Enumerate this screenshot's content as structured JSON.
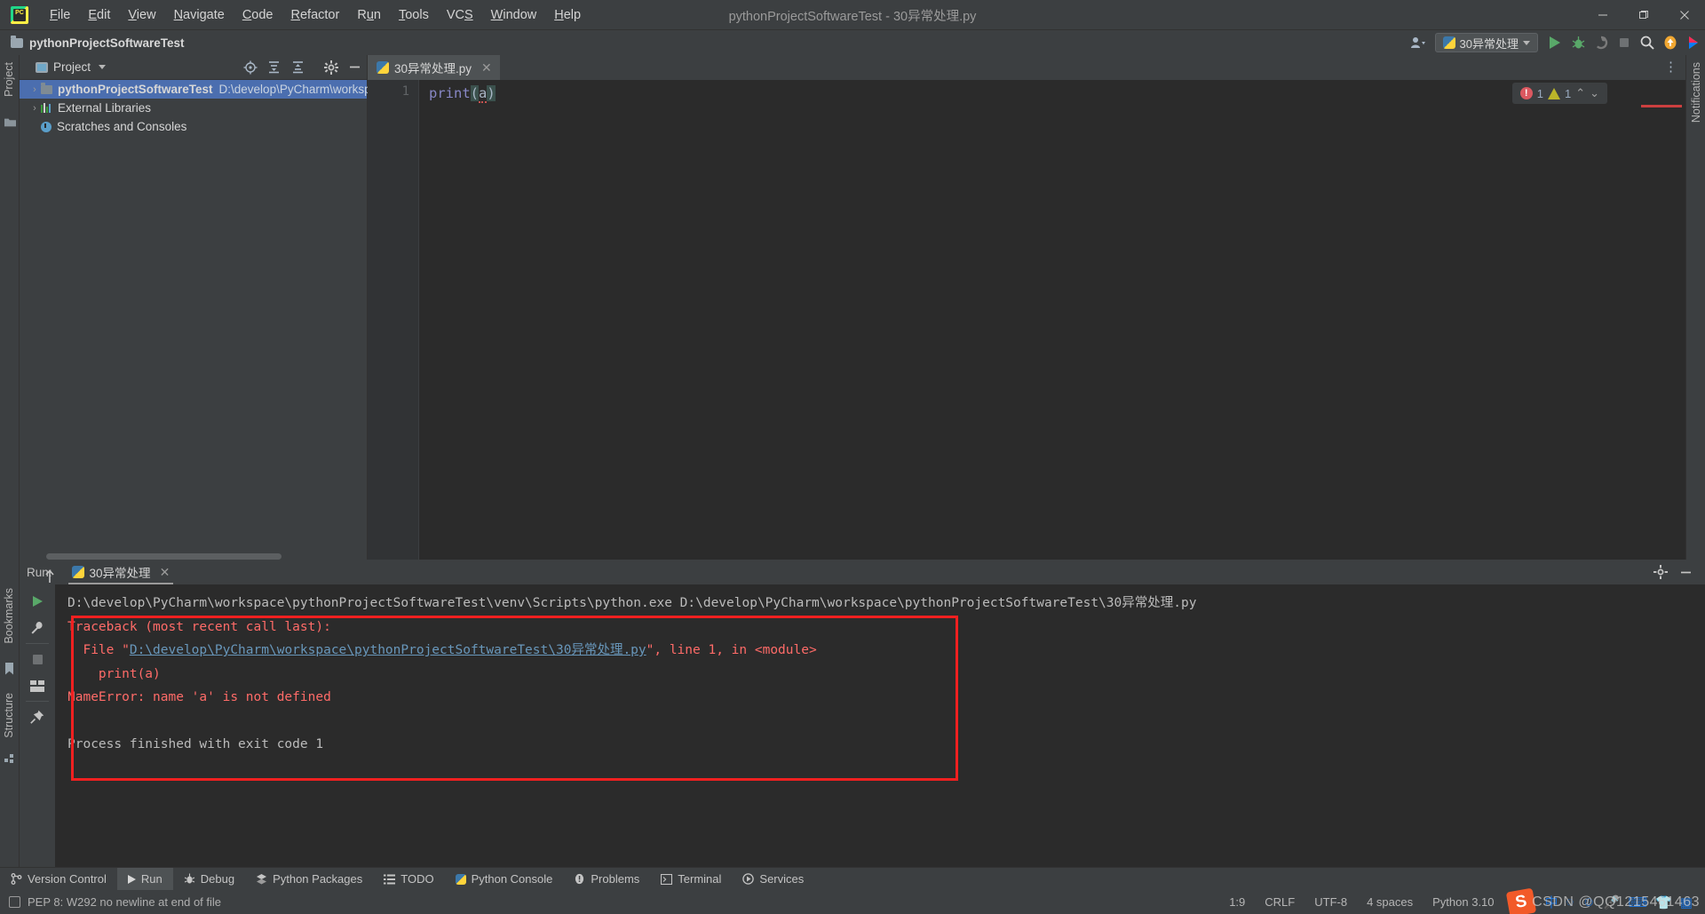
{
  "window": {
    "title": "pythonProjectSoftwareTest - 30异常处理.py",
    "minimize": "—",
    "maximize": "❐",
    "close": "✕"
  },
  "menu": {
    "items": [
      {
        "label": "File",
        "mnemonic": "F"
      },
      {
        "label": "Edit",
        "mnemonic": "E"
      },
      {
        "label": "View",
        "mnemonic": "V"
      },
      {
        "label": "Navigate",
        "mnemonic": "N"
      },
      {
        "label": "Code",
        "mnemonic": "C"
      },
      {
        "label": "Refactor",
        "mnemonic": "R"
      },
      {
        "label": "Run",
        "mnemonic": "u"
      },
      {
        "label": "Tools",
        "mnemonic": "T"
      },
      {
        "label": "VCS",
        "mnemonic": "S"
      },
      {
        "label": "Window",
        "mnemonic": "W"
      },
      {
        "label": "Help",
        "mnemonic": "H"
      }
    ]
  },
  "navbar": {
    "breadcrumb": "pythonProjectSoftwareTest",
    "run_config": "30异常处理",
    "icons": {
      "account": "account-icon",
      "run": "run-icon",
      "debug": "debug-icon",
      "coverage": "coverage-icon",
      "stop": "stop-icon",
      "search": "search-icon",
      "update": "update-icon",
      "ide_extras": "ide-extras-icon"
    }
  },
  "left_strip": {
    "project_label": "Project",
    "bookmarks_label": "Bookmarks",
    "structure_label": "Structure"
  },
  "right_strip": {
    "notifications_label": "Notifications"
  },
  "project_panel": {
    "title": "Project",
    "toolbar_icons": [
      "locate-icon",
      "expand-all-icon",
      "collapse-all-icon",
      "settings-icon",
      "hide-icon"
    ],
    "tree": [
      {
        "label": "pythonProjectSoftwareTest",
        "path": "D:\\develop\\PyCharm\\worksp",
        "icon": "folder-icon",
        "arrow": "›",
        "selected": true,
        "depth": 0
      },
      {
        "label": "External Libraries",
        "path": "",
        "icon": "library-icon",
        "arrow": "›",
        "selected": false,
        "depth": 0
      },
      {
        "label": "Scratches and Consoles",
        "path": "",
        "icon": "scratches-icon",
        "arrow": "",
        "selected": false,
        "depth": 0
      }
    ]
  },
  "editor": {
    "tab": {
      "label": "30异常处理.py",
      "icon": "python-file-icon",
      "close": "✕"
    },
    "overflow_icon": "⋮",
    "line_numbers": [
      "1"
    ],
    "code_line": {
      "fn": "print",
      "open_paren": "(",
      "arg": "a",
      "close_paren": ")"
    },
    "inspection": {
      "errors": "1",
      "warnings": "1",
      "up": "⌃",
      "down": "⌄"
    }
  },
  "run_panel": {
    "label": "Run:",
    "tab": "30异常处理",
    "tab_close": "✕",
    "header_icons": [
      "settings-icon",
      "hide-icon"
    ],
    "side_icons": [
      "rerun-icon",
      "wrench-icon",
      "stop-icon",
      "layout-icon",
      "pin-icon",
      "up-icon",
      "down-icon",
      "soft-wrap-icon",
      "scroll-end-icon",
      "print-icon",
      "clear-icon"
    ],
    "console": {
      "command": "D:\\develop\\PyCharm\\workspace\\pythonProjectSoftwareTest\\venv\\Scripts\\python.exe D:\\develop\\PyCharm\\workspace\\pythonProjectSoftwareTest\\30异常处理.py",
      "traceback_header": "Traceback (most recent call last):",
      "file_prefix": "  File \"",
      "file_link": "D:\\develop\\PyCharm\\workspace\\pythonProjectSoftwareTest\\30异常处理.py",
      "file_suffix": "\", line 1, in <module>",
      "source_line": "    print(a)",
      "error_line": "NameError: name 'a' is not defined",
      "exit_line": "Process finished with exit code 1"
    }
  },
  "tool_windows": [
    {
      "label": "Version Control",
      "icon": "branch-icon",
      "active": false
    },
    {
      "label": "Run",
      "icon": "run-icon",
      "active": true
    },
    {
      "label": "Debug",
      "icon": "debug-icon",
      "active": false
    },
    {
      "label": "Python Packages",
      "icon": "packages-icon",
      "active": false
    },
    {
      "label": "TODO",
      "icon": "todo-icon",
      "active": false
    },
    {
      "label": "Python Console",
      "icon": "python-icon",
      "active": false
    },
    {
      "label": "Problems",
      "icon": "problems-icon",
      "active": false
    },
    {
      "label": "Terminal",
      "icon": "terminal-icon",
      "active": false
    },
    {
      "label": "Services",
      "icon": "services-icon",
      "active": false
    }
  ],
  "status_bar": {
    "message": "PEP 8: W292 no newline at end of file",
    "caret": "1:9",
    "line_sep": "CRLF",
    "encoding": "UTF-8",
    "indent": "4 spaces",
    "interpreter": "Python 3.10",
    "ime_logo": "S",
    "watermark": "CSDN @QQ1215461463"
  },
  "colors": {
    "accent_selection": "#4b6eaf",
    "error_red": "#ff6b68",
    "highlight_box": "#f02020",
    "link_blue": "#6897bb",
    "run_green": "#59a869"
  }
}
